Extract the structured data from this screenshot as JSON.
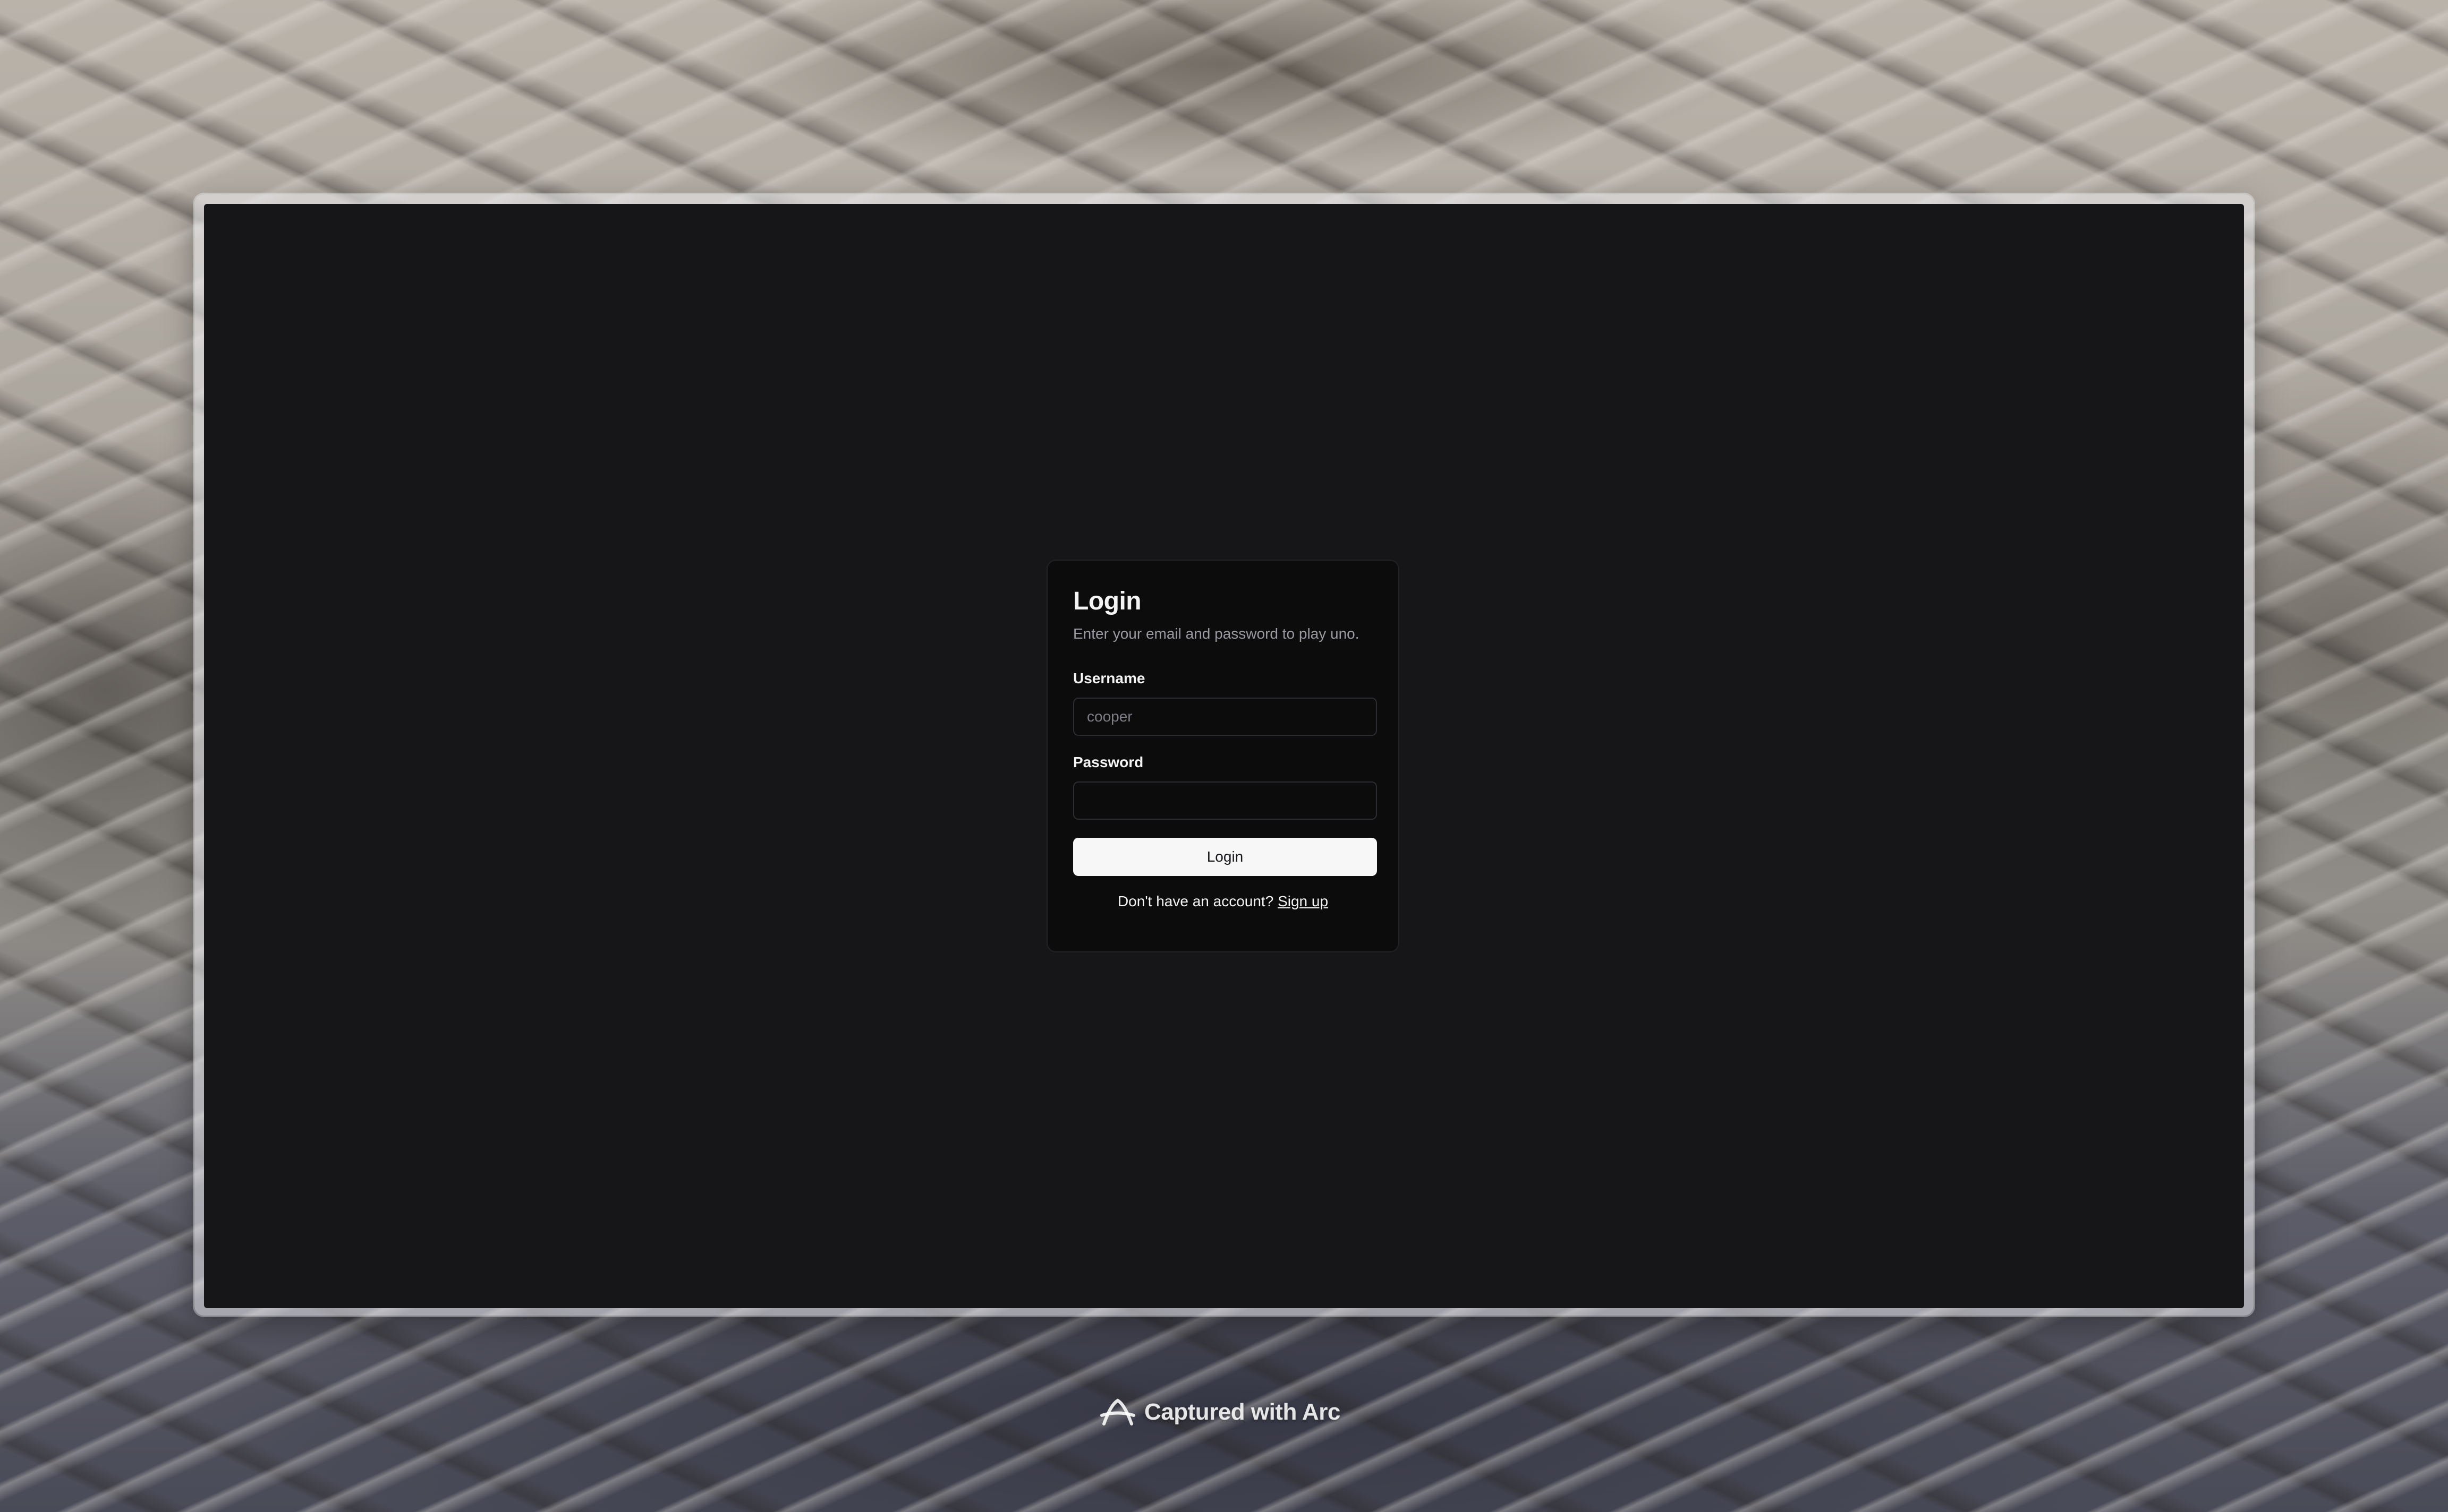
{
  "login": {
    "title": "Login",
    "description": "Enter your email and password to play uno.",
    "username_label": "Username",
    "username_placeholder": "cooper",
    "username_value": "",
    "password_label": "Password",
    "password_value": "",
    "submit_label": "Login",
    "signup_prompt": "Don't have an account?",
    "signup_link": "Sign up"
  },
  "watermark": {
    "icon": "arc-logo-icon",
    "text": "Captured with Arc"
  },
  "colors": {
    "page_background": "#161618",
    "card_background": "#0c0c0d",
    "button_background": "#f7f7f8",
    "muted_text": "#9a9aa2"
  }
}
